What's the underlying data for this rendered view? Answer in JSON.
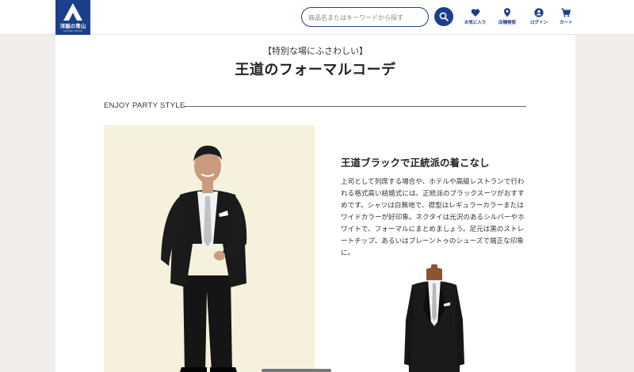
{
  "header": {
    "logo_text": "洋服の青山",
    "logo_sub": "AOYAMA TAILOR",
    "search": {
      "placeholder": "商品名またはキーワードから探す"
    },
    "nav": [
      {
        "label": "お気に入り",
        "icon": "heart-icon"
      },
      {
        "label": "店舗検索",
        "icon": "map-pin-icon"
      },
      {
        "label": "ログイン",
        "icon": "user-icon"
      },
      {
        "label": "カート",
        "icon": "cart-icon"
      }
    ]
  },
  "main": {
    "eyebrow": "【特別な場にふさわしい】",
    "title": "王道のフォーマルコーデ",
    "section_label": "ENJOY PARTY STYLE",
    "sub_title": "王道ブラックで正統派の着こなし",
    "body": "上司として列席する場合や、ホテルや高級レストランで行われる格式高い結婚式には、正統派のブラックスーツがおすすめです。シャツは白無地で、襟型はレギュラーカラーまたはワイドカラーが好印象。ネクタイは光沢のあるシルバーやホワイトで、フォーマルにまとめましょう。足元は黒のストレートチップ、あるいはプレーントゥのシューズで端正な印象に。"
  },
  "colors": {
    "brand": "#1b3f8c",
    "panel": "#ffffff",
    "background": "#f1eeea",
    "photo_bg": "#f6f1dc"
  }
}
